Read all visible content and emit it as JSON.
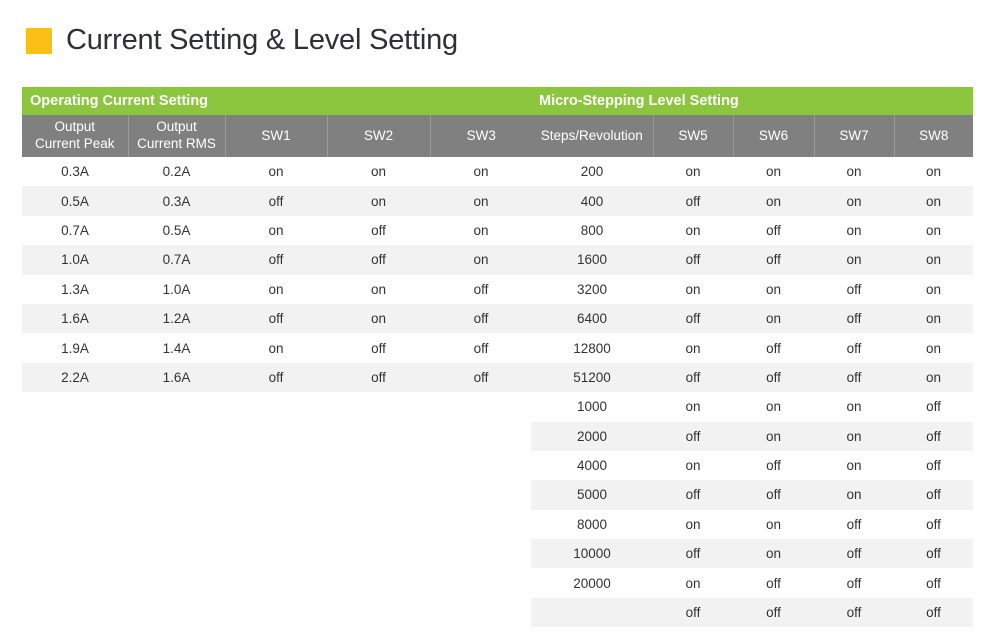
{
  "title": {
    "text": "Current Setting & Level Setting",
    "marker_color": "#fbc015",
    "text_color": "#2f3032"
  },
  "theme": {
    "group_header_bg": "#8cc63f",
    "column_header_bg": "#808080",
    "row_stripe_bg": "#f2f2f2",
    "row_bg": "#ffffff"
  },
  "tables": [
    {
      "id": "operating-current-setting",
      "group_header": "Operating Current Setting",
      "columns": [
        "Output\nCurrent Peak",
        "Output\nCurrent RMS",
        "SW1",
        "SW2",
        "SW3"
      ],
      "column_lines": [
        [
          "Output",
          "Current Peak"
        ],
        [
          "Output",
          "Current RMS"
        ],
        [
          "SW1"
        ],
        [
          "SW2"
        ],
        [
          "SW3"
        ]
      ],
      "rows": [
        [
          "0.3A",
          "0.2A",
          "on",
          "on",
          "on"
        ],
        [
          "0.5A",
          "0.3A",
          "off",
          "on",
          "on"
        ],
        [
          "0.7A",
          "0.5A",
          "on",
          "off",
          "on"
        ],
        [
          "1.0A",
          "0.7A",
          "off",
          "off",
          "on"
        ],
        [
          "1.3A",
          "1.0A",
          "on",
          "on",
          "off"
        ],
        [
          "1.6A",
          "1.2A",
          "off",
          "on",
          "off"
        ],
        [
          "1.9A",
          "1.4A",
          "on",
          "off",
          "off"
        ],
        [
          "2.2A",
          "1.6A",
          "off",
          "off",
          "off"
        ]
      ]
    },
    {
      "id": "micro-stepping-level-setting",
      "group_header": "Micro-Stepping Level Setting",
      "columns": [
        "Steps/Revolution",
        "SW5",
        "SW6",
        "SW7",
        "SW8"
      ],
      "column_lines": [
        [
          "Steps/Revolution"
        ],
        [
          "SW5"
        ],
        [
          "SW6"
        ],
        [
          "SW7"
        ],
        [
          "SW8"
        ]
      ],
      "rows": [
        [
          "200",
          "on",
          "on",
          "on",
          "on"
        ],
        [
          "400",
          "off",
          "on",
          "on",
          "on"
        ],
        [
          "800",
          "on",
          "off",
          "on",
          "on"
        ],
        [
          "1600",
          "off",
          "off",
          "on",
          "on"
        ],
        [
          "3200",
          "on",
          "on",
          "off",
          "on"
        ],
        [
          "6400",
          "off",
          "on",
          "off",
          "on"
        ],
        [
          "12800",
          "on",
          "off",
          "off",
          "on"
        ],
        [
          "51200",
          "off",
          "off",
          "off",
          "on"
        ],
        [
          "1000",
          "on",
          "on",
          "on",
          "off"
        ],
        [
          "2000",
          "off",
          "on",
          "on",
          "off"
        ],
        [
          "4000",
          "on",
          "off",
          "on",
          "off"
        ],
        [
          "5000",
          "off",
          "off",
          "on",
          "off"
        ],
        [
          "8000",
          "on",
          "on",
          "off",
          "off"
        ],
        [
          "10000",
          "off",
          "on",
          "off",
          "off"
        ],
        [
          "20000",
          "on",
          "off",
          "off",
          "off"
        ],
        [
          "",
          "off",
          "off",
          "off",
          "off"
        ]
      ]
    }
  ]
}
